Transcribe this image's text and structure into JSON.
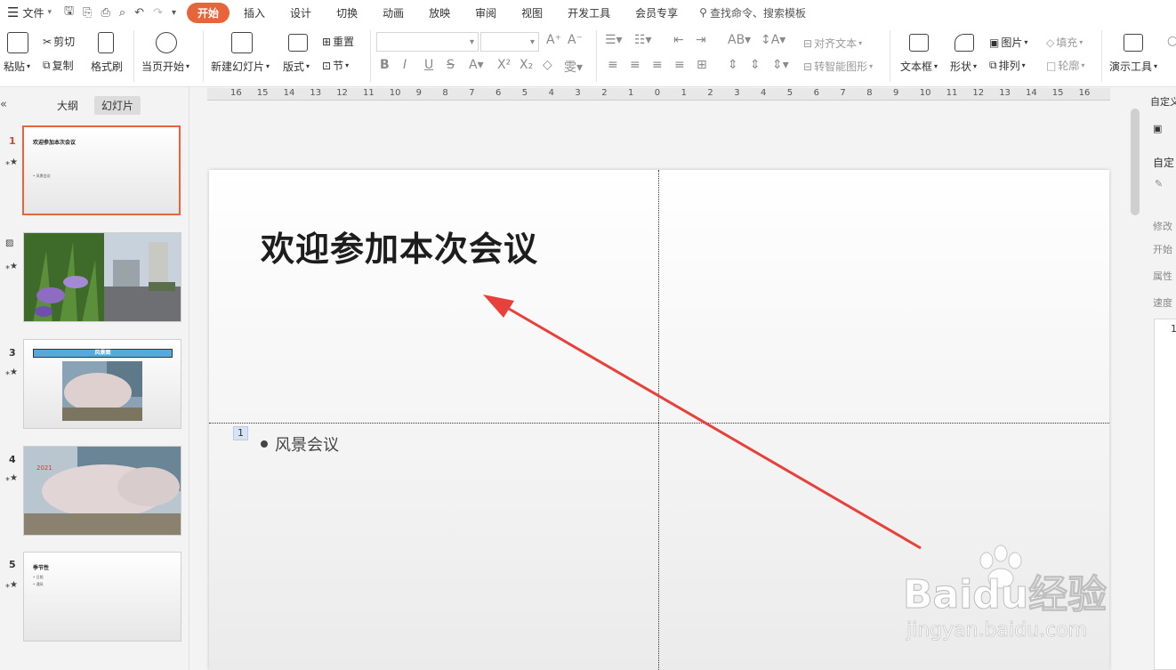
{
  "menubar": {
    "menu_label": "文件",
    "tabs": [
      "开始",
      "插入",
      "设计",
      "切换",
      "动画",
      "放映",
      "审阅",
      "视图",
      "开发工具",
      "会员专享"
    ],
    "search_text": "查找命令、搜索模板"
  },
  "ribbon": {
    "paste": "粘贴",
    "cut": "剪切",
    "copy": "复制",
    "format_painter": "格式刷",
    "from_current": "当页开始",
    "new_slide": "新建幻灯片",
    "layout": "版式",
    "reset": "重置",
    "section": "节",
    "align_text": "对齐文本",
    "smart_art": "转智能图形",
    "textbox": "文本框",
    "shape": "形状",
    "picture": "图片",
    "arrange": "排列",
    "fill": "填充",
    "outline": "轮廓",
    "present_tools": "演示工具"
  },
  "left_panel": {
    "tabs": [
      "大纲",
      "幻灯片"
    ],
    "active_tab": "幻灯片",
    "thumbnails": [
      {
        "num": "1",
        "title": "欢迎参加本次会议",
        "sub": "• 风景会议"
      },
      {
        "num": "",
        "title": "",
        "sub": ""
      },
      {
        "num": "3",
        "title": "风景图",
        "sub": ""
      },
      {
        "num": "4",
        "title": "2021",
        "sub": ""
      },
      {
        "num": "5",
        "title": "季节性",
        "sub": "• 日照\n• 通风"
      }
    ]
  },
  "ruler": {
    "labels": [
      "16",
      "15",
      "14",
      "13",
      "12",
      "11",
      "10",
      "9",
      "8",
      "7",
      "6",
      "5",
      "4",
      "3",
      "2",
      "1",
      "0",
      "1",
      "2",
      "3",
      "4",
      "5",
      "6",
      "7",
      "8",
      "9",
      "10",
      "11",
      "12",
      "13",
      "14",
      "15",
      "16"
    ]
  },
  "slide": {
    "title": "欢迎参加本次会议",
    "placeholder_number": "1",
    "bullet": "风景会议"
  },
  "right_panel": {
    "header": "自定义",
    "custom": "自定",
    "modify": "修改",
    "start": "开始",
    "property": "属性",
    "speed": "速度",
    "list_num": "1"
  },
  "watermark": {
    "main": "Baidu经验",
    "sub": "jingyan.baidu.com"
  },
  "colors": {
    "accent": "#e8643b",
    "arrow": "#e8403a",
    "banner": "#56a9de"
  }
}
